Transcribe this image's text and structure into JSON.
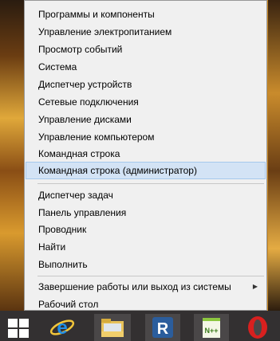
{
  "menu": {
    "items": [
      {
        "label": "Программы и компоненты"
      },
      {
        "label": "Управление электропитанием"
      },
      {
        "label": "Просмотр событий"
      },
      {
        "label": "Система"
      },
      {
        "label": "Диспетчер устройств"
      },
      {
        "label": "Сетевые подключения"
      },
      {
        "label": "Управление дисками"
      },
      {
        "label": "Управление компьютером"
      },
      {
        "label": "Командная строка"
      },
      {
        "label": "Командная строка (администратор)",
        "selected": true
      },
      {
        "label": "Диспетчер задач"
      },
      {
        "label": "Панель управления"
      },
      {
        "label": "Проводник"
      },
      {
        "label": "Найти"
      },
      {
        "label": "Выполнить"
      },
      {
        "label": "Завершение работы или выход из системы",
        "has_submenu": true
      },
      {
        "label": "Рабочий стол"
      }
    ]
  },
  "taskbar": {
    "icons": [
      "windows-start-icon",
      "internet-explorer-icon",
      "file-explorer-icon",
      "r-app-icon",
      "notepad-plus-plus-icon",
      "opera-icon"
    ],
    "notepad_icon_text": "N++"
  },
  "colors": {
    "menu_bg": "#f0f0f0",
    "selected_bg": "#d3e3f5",
    "taskbar_bg": "#333031",
    "wallpaper": "#c9861e"
  }
}
